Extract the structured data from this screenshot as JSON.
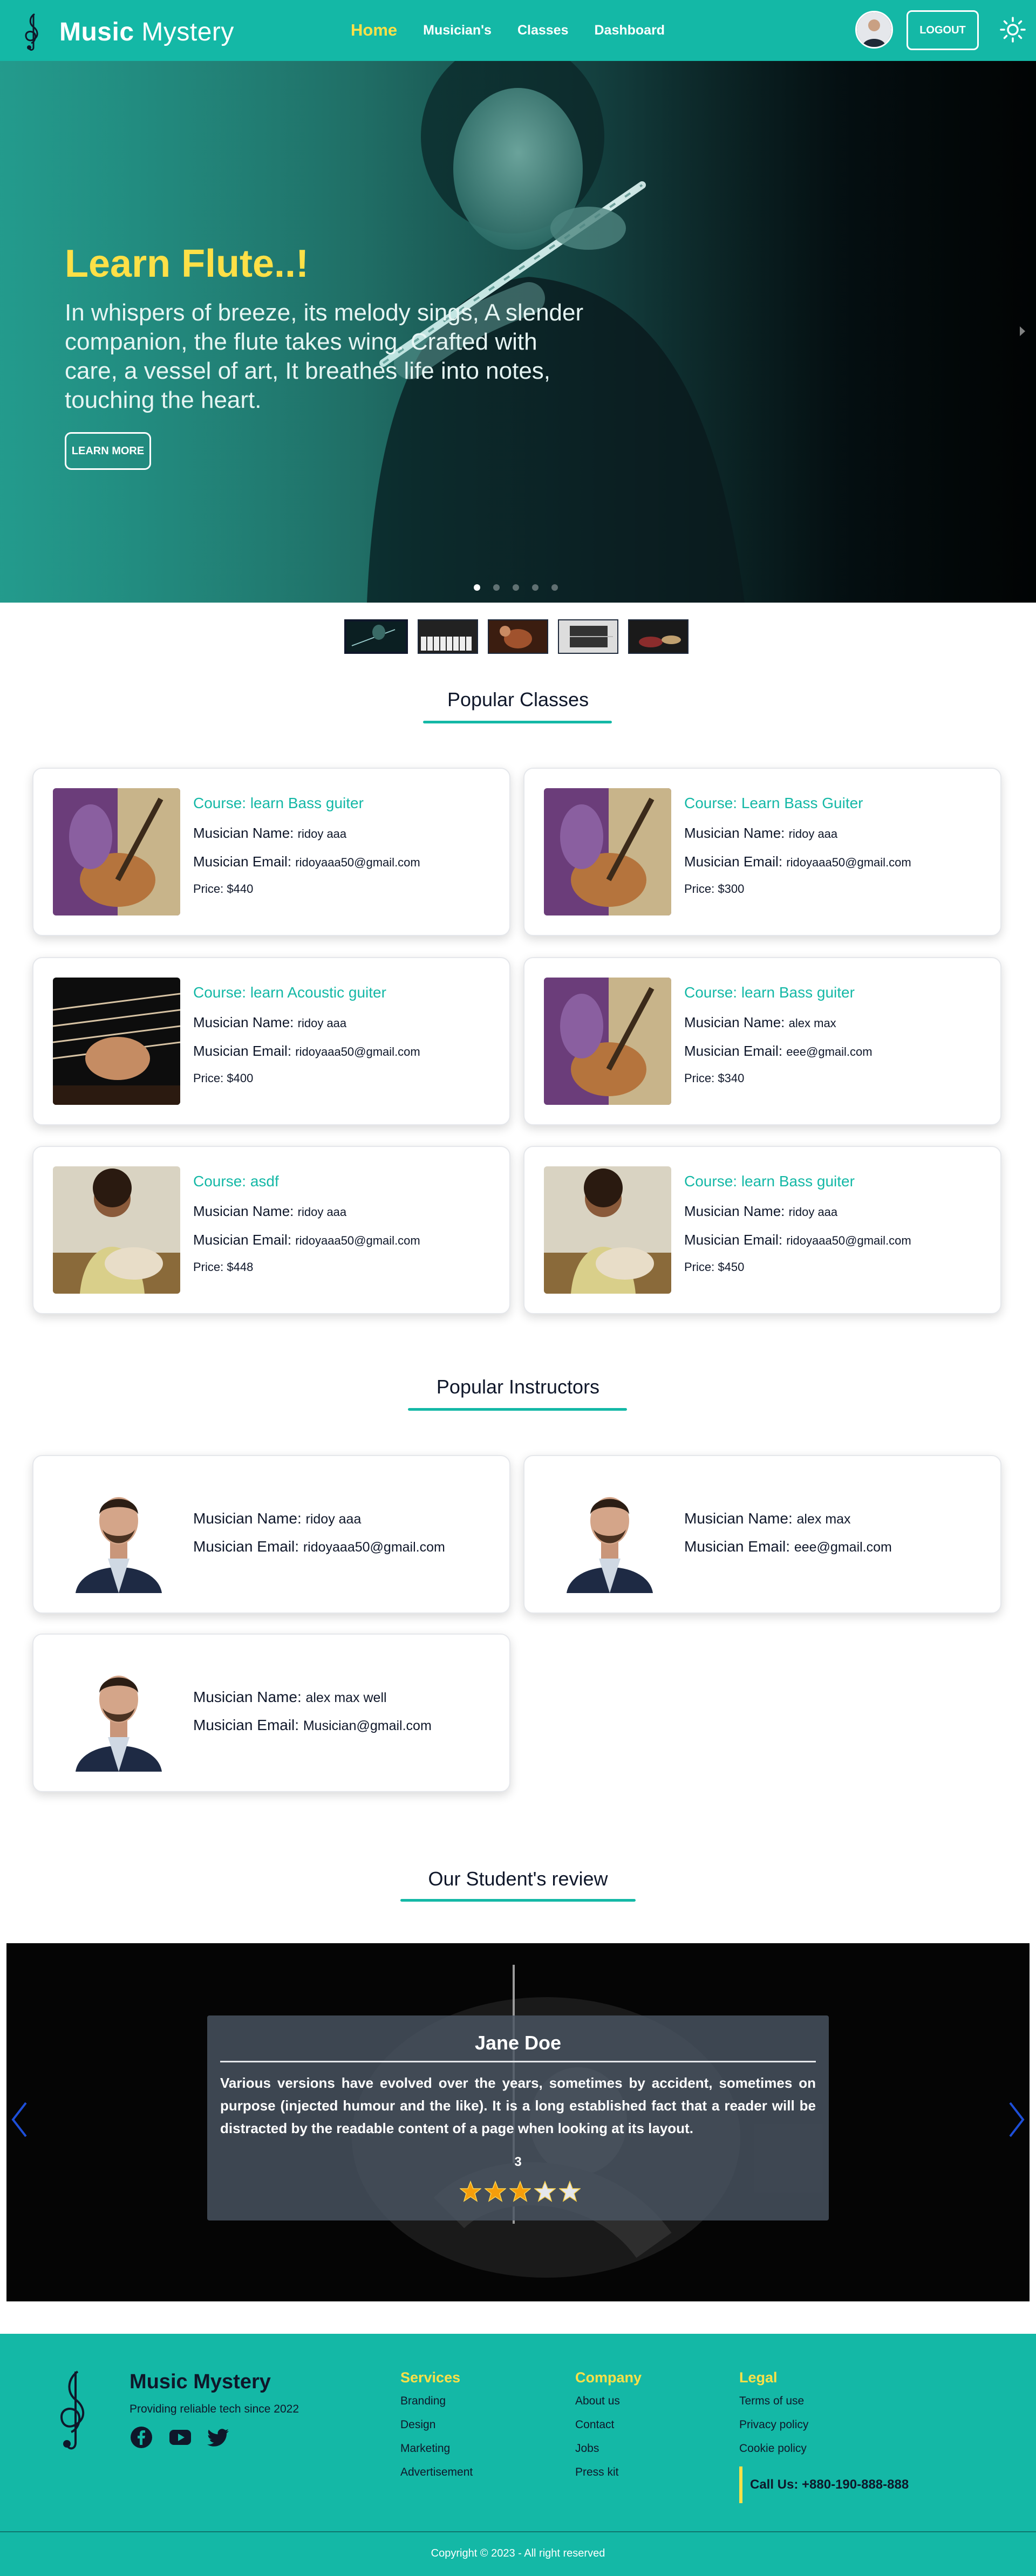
{
  "navbar": {
    "brand_bold": "Music",
    "brand_light": "Mystery",
    "links": [
      {
        "label": "Home",
        "active": true
      },
      {
        "label": "Musician's",
        "active": false
      },
      {
        "label": "Classes",
        "active": false
      },
      {
        "label": "Dashboard",
        "active": false
      }
    ],
    "logout_label": "LOGOUT",
    "theme_icon": "sun-icon"
  },
  "hero": {
    "title": "Learn Flute..!",
    "text": "In whispers of breeze, its melody sings, A slender companion, the flute takes wing. Crafted with care, a vessel of art, It breathes life into notes, touching the heart.",
    "button_label": "LEARN MORE",
    "slide_count": 5,
    "active_slide": 1
  },
  "popular_classes": {
    "title": "Popular Classes",
    "name_label": "Musician Name:",
    "email_label": "Musician Email:",
    "price_label": "Price:",
    "items": [
      {
        "course": "Course: learn Bass guiter",
        "name": "ridoy aaa",
        "email": "ridoyaaa50@gmail.com",
        "price": "$440"
      },
      {
        "course": "Course: Learn Bass Guiter",
        "name": "ridoy aaa",
        "email": "ridoyaaa50@gmail.com",
        "price": "$300"
      },
      {
        "course": "Course: learn Acoustic guiter",
        "name": "ridoy aaa",
        "email": "ridoyaaa50@gmail.com",
        "price": "$400"
      },
      {
        "course": "Course: learn Bass guiter",
        "name": "alex max",
        "email": "eee@gmail.com",
        "price": "$340"
      },
      {
        "course": "Course: asdf",
        "name": "ridoy aaa",
        "email": "ridoyaaa50@gmail.com",
        "price": "$448"
      },
      {
        "course": "Course: learn Bass guiter",
        "name": "ridoy aaa",
        "email": "ridoyaaa50@gmail.com",
        "price": "$450"
      }
    ]
  },
  "popular_instructors": {
    "title": "Popular Instructors",
    "name_label": "Musician Name:",
    "email_label": "Musician Email:",
    "items": [
      {
        "name": "ridoy aaa",
        "email": "ridoyaaa50@gmail.com"
      },
      {
        "name": "alex max",
        "email": "eee@gmail.com"
      },
      {
        "name": "alex max well",
        "email": "Musician@gmail.com"
      }
    ]
  },
  "reviews": {
    "title": "Our Student's review",
    "name": "Jane Doe",
    "text": "Various versions have evolved over the years, sometimes by accident, sometimes on purpose (injected humour and the like). It is a long established fact that a reader will be distracted by the readable content of a page when looking at its layout.",
    "rating": "3",
    "stars": 5
  },
  "footer": {
    "brand": "Music Mystery",
    "tagline": "Providing reliable tech since 2022",
    "social": [
      "facebook-icon",
      "youtube-icon",
      "twitter-icon"
    ],
    "services": {
      "title": "Services",
      "links": [
        "Branding",
        "Design",
        "Marketing",
        "Advertisement"
      ]
    },
    "company": {
      "title": "Company",
      "links": [
        "About us",
        "Contact",
        "Jobs",
        "Press kit"
      ]
    },
    "legal": {
      "title": "Legal",
      "links": [
        "Terms of use",
        "Privacy policy",
        "Cookie policy"
      ]
    },
    "call_us": "Call Us: +880-190-888-888",
    "copyright": "Copyright © 2023 - All right reserved"
  },
  "colors": {
    "primary": "#14b8a6",
    "accent": "#fde047",
    "text": "#0f172a"
  }
}
